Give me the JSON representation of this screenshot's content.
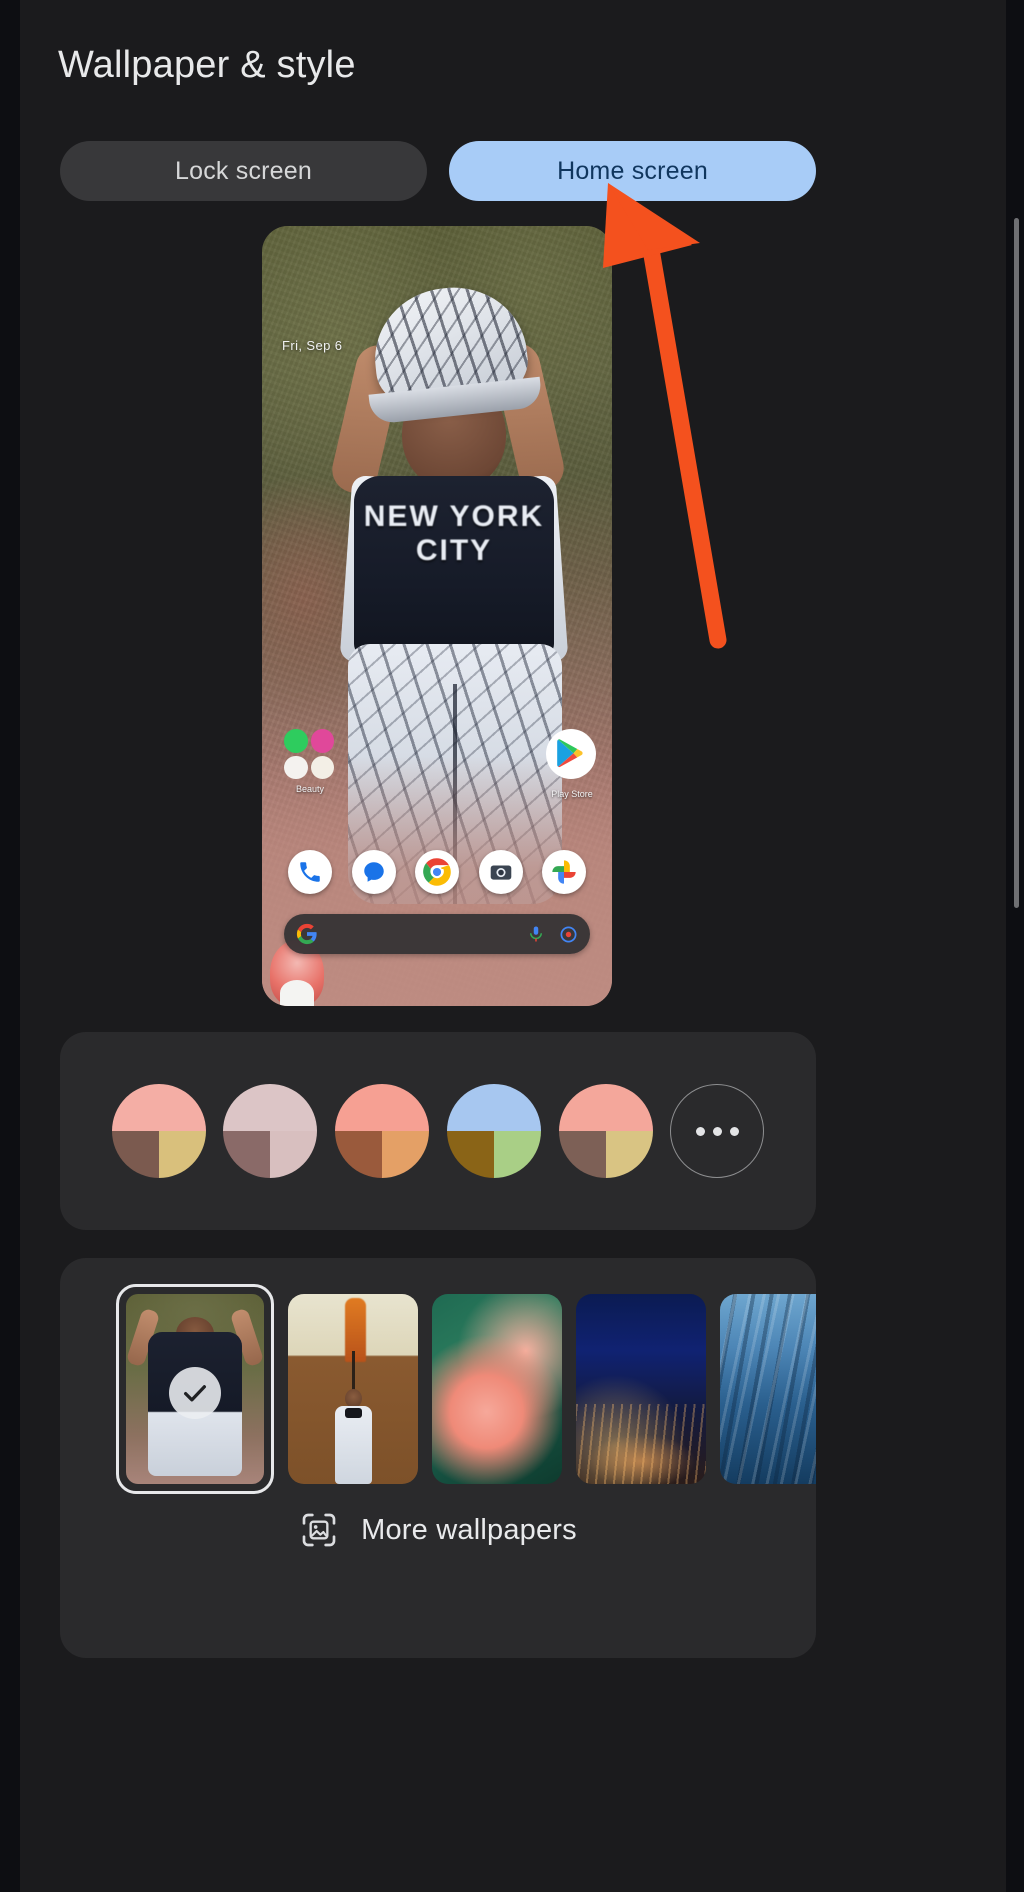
{
  "header": {
    "title": "Wallpaper & style"
  },
  "tabs": [
    {
      "label": "Lock screen",
      "active": false
    },
    {
      "label": "Home screen",
      "active": true
    }
  ],
  "preview": {
    "date_text": "Fri, Sep 6",
    "folder_label": "Beauty",
    "playstore_label": "Play Store",
    "dock_icons": [
      "phone-icon",
      "messages-icon",
      "chrome-icon",
      "camera-icon",
      "photos-icon"
    ],
    "search_bar": {
      "google_icon": "google-g-icon",
      "mic_icon": "microphone-icon",
      "lens_icon": "google-lens-icon"
    }
  },
  "palette": {
    "swatches": [
      {
        "name": "swatch-1",
        "top": "#f4aea5",
        "bottom_left": "#7b5a4f",
        "bottom_right": "#d9c07c",
        "selected": false
      },
      {
        "name": "swatch-2",
        "top": "#dcc5c6",
        "bottom_left": "#8a6a68",
        "bottom_right": "#d8bfbf",
        "selected": false
      },
      {
        "name": "swatch-3",
        "top": "#f6a093",
        "bottom_left": "#9a5a3c",
        "bottom_right": "#e4a濃66",
        "selected": false
      },
      {
        "name": "swatch-4",
        "top": "#a7c7f0",
        "bottom_left": "#8a6417",
        "bottom_right": "#a9cf86",
        "selected": false
      },
      {
        "name": "swatch-5",
        "top": "#f4a79b",
        "bottom_left": "#7d6056",
        "bottom_right": "#d9c483",
        "selected": false
      }
    ],
    "more_button": {
      "label": "more-colors",
      "icon": "ellipsis-icon"
    }
  },
  "wallpapers": {
    "thumbnails": [
      {
        "name": "wallpaper-thumb-child-cap",
        "selected": true,
        "badge": "check-icon"
      },
      {
        "name": "wallpaper-thumb-boy-bowtie",
        "selected": false
      },
      {
        "name": "wallpaper-thumb-pink-flower",
        "selected": false
      },
      {
        "name": "wallpaper-thumb-night-city",
        "selected": false
      },
      {
        "name": "wallpaper-thumb-blue-water",
        "selected": false
      }
    ],
    "more_label": "More wallpapers",
    "more_icon": "image-placeholder-icon"
  },
  "annotation": {
    "type": "arrow",
    "color": "#f4511e",
    "points_to": "Home screen"
  },
  "colors": {
    "background": "#1b1b1d",
    "card": "#2a2a2c",
    "tab_inactive_bg": "#38383a",
    "tab_active_bg": "#a8ccf7",
    "tab_active_text": "#10365e",
    "text_primary": "#e8e9ea",
    "scrollbar": "#6f7073"
  }
}
